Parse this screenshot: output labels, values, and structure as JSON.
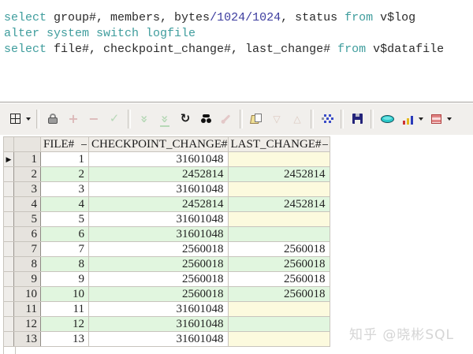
{
  "sql_editor": {
    "colors": {
      "keyword": "#3f9d9d",
      "plain": "#2b2b2b",
      "number": "#3c3c9e"
    },
    "lines": [
      {
        "tokens": [
          {
            "text": "select ",
            "type": "keyword"
          },
          {
            "text": "group#, members, bytes",
            "type": "plain"
          },
          {
            "text": "/1024/1024",
            "type": "number"
          },
          {
            "text": ", status ",
            "type": "plain"
          },
          {
            "text": "from ",
            "type": "keyword"
          },
          {
            "text": "v$log",
            "type": "plain"
          }
        ]
      },
      {
        "tokens": [
          {
            "text": "alter system switch logfile",
            "type": "keyword"
          }
        ]
      },
      {
        "tokens": [
          {
            "text": "select ",
            "type": "keyword"
          },
          {
            "text": "file#, checkpoint_change#, last_change# ",
            "type": "plain"
          },
          {
            "text": "from ",
            "type": "keyword"
          },
          {
            "text": "v$datafile",
            "type": "plain"
          }
        ]
      }
    ]
  },
  "toolbar": {
    "items": [
      {
        "name": "grid-options",
        "caret": true,
        "enabled": true
      },
      {
        "name": "separator"
      },
      {
        "name": "lock-data",
        "enabled": true
      },
      {
        "name": "insert-record",
        "enabled": false
      },
      {
        "name": "delete-record",
        "enabled": false
      },
      {
        "name": "post-changes",
        "enabled": false
      },
      {
        "name": "separator"
      },
      {
        "name": "fetch-next-page",
        "enabled": false
      },
      {
        "name": "fetch-last-page",
        "enabled": false
      },
      {
        "name": "refresh-query",
        "enabled": true
      },
      {
        "name": "find",
        "enabled": true
      },
      {
        "name": "edit-pencil",
        "enabled": false
      },
      {
        "name": "separator"
      },
      {
        "name": "copy-to-export",
        "enabled": true
      },
      {
        "name": "sort-descending",
        "enabled": false
      },
      {
        "name": "sort-ascending",
        "enabled": false
      },
      {
        "name": "separator"
      },
      {
        "name": "data-filter",
        "enabled": true
      },
      {
        "name": "separator"
      },
      {
        "name": "save-results",
        "enabled": true
      },
      {
        "name": "separator"
      },
      {
        "name": "single-record-view",
        "enabled": true
      },
      {
        "name": "chart",
        "caret": true,
        "enabled": true
      },
      {
        "name": "report",
        "caret": true,
        "enabled": true
      }
    ]
  },
  "results_grid": {
    "columns": [
      "FILE#",
      "CHECKPOINT_CHANGE#",
      "LAST_CHANGE#"
    ],
    "colors": {
      "alt_row_green": "#e1f6df",
      "null_cell_yellow": "#fcfade"
    },
    "rows": [
      {
        "row_number": "1",
        "current": true,
        "file": "1",
        "checkpoint_change": "31601048",
        "last_change": ""
      },
      {
        "row_number": "2",
        "current": false,
        "file": "2",
        "checkpoint_change": "2452814",
        "last_change": "2452814"
      },
      {
        "row_number": "3",
        "current": false,
        "file": "3",
        "checkpoint_change": "31601048",
        "last_change": ""
      },
      {
        "row_number": "4",
        "current": false,
        "file": "4",
        "checkpoint_change": "2452814",
        "last_change": "2452814"
      },
      {
        "row_number": "5",
        "current": false,
        "file": "5",
        "checkpoint_change": "31601048",
        "last_change": ""
      },
      {
        "row_number": "6",
        "current": false,
        "file": "6",
        "checkpoint_change": "31601048",
        "last_change": ""
      },
      {
        "row_number": "7",
        "current": false,
        "file": "7",
        "checkpoint_change": "2560018",
        "last_change": "2560018"
      },
      {
        "row_number": "8",
        "current": false,
        "file": "8",
        "checkpoint_change": "2560018",
        "last_change": "2560018"
      },
      {
        "row_number": "9",
        "current": false,
        "file": "9",
        "checkpoint_change": "2560018",
        "last_change": "2560018"
      },
      {
        "row_number": "10",
        "current": false,
        "file": "10",
        "checkpoint_change": "2560018",
        "last_change": "2560018"
      },
      {
        "row_number": "11",
        "current": false,
        "file": "11",
        "checkpoint_change": "31601048",
        "last_change": ""
      },
      {
        "row_number": "12",
        "current": false,
        "file": "12",
        "checkpoint_change": "31601048",
        "last_change": ""
      },
      {
        "row_number": "13",
        "current": false,
        "file": "13",
        "checkpoint_change": "31601048",
        "last_change": ""
      }
    ],
    "current_row_marker": "▶"
  },
  "watermark": {
    "text": "知乎 @晓彬SQL"
  }
}
